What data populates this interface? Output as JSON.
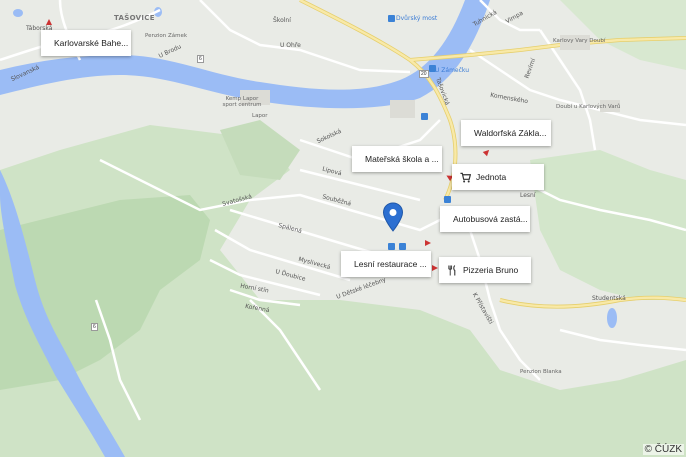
{
  "map": {
    "area_labels": [
      "TAŠOVICE"
    ],
    "street_labels": [
      "Táborská",
      "U Brodu",
      "Slovanská",
      "U Ohře",
      "Školní",
      "Tašovická",
      "Sokolská",
      "Lipová",
      "Souběžná",
      "Svatošská",
      "Spálená",
      "Myslivecká",
      "U Ďoubice",
      "Horní stín",
      "Kořenná",
      "U Dětské léčebny",
      "Studentská",
      "K Přístavišti",
      "Komenského",
      "Lesní",
      "Vimpa",
      "Revírní",
      "Tuhnická"
    ],
    "place_labels": [
      "Dvůrský most",
      "Penzion Zámek",
      "Kemp Lapor sport centrum",
      "Lapor",
      "Karlovy Vary Doubí",
      "Doubí u Karlových Varů",
      "U Zámečku",
      "Penzion Blanka"
    ],
    "road_numbers": [
      "20",
      "6",
      "6"
    ],
    "attribution": "© ČÚZK"
  },
  "pois": [
    {
      "label": "Karlovarské Bahe...",
      "icon": "network-icon",
      "name": "poi-karlovarske"
    },
    {
      "label": "Waldorfská Zákla...",
      "icon": "school-icon",
      "name": "poi-waldorfska"
    },
    {
      "label": "Mateřská škola a ...",
      "icon": "school-icon",
      "name": "poi-materska"
    },
    {
      "label": "Jednota",
      "icon": "cart-icon",
      "name": "poi-jednota"
    },
    {
      "label": "Autobusová zastá...",
      "icon": "location-icon",
      "name": "poi-autobusova"
    },
    {
      "label": "Lesní restaurace ...",
      "icon": "restaurant-icon",
      "name": "poi-lesni"
    },
    {
      "label": "Pizzeria Bruno",
      "icon": "restaurant-icon",
      "name": "poi-pizzeria"
    }
  ],
  "colors": {
    "water": "#9bbcf5",
    "forest": "#c8dfc0",
    "road_major": "#f6e39a",
    "pin": "#2c6fd1"
  }
}
